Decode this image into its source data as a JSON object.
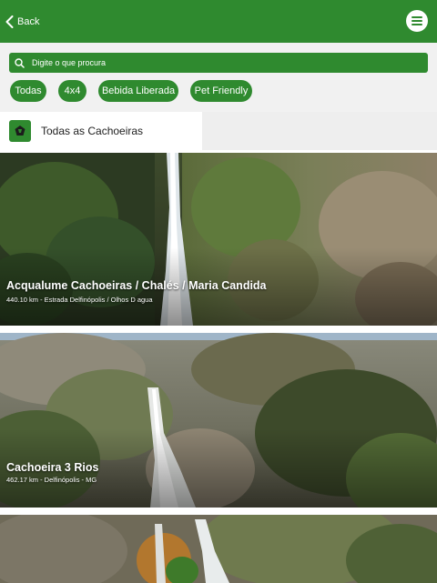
{
  "header": {
    "back_label": "Back",
    "back_icon": "chevron-left-icon",
    "menu_icon": "hamburger-menu-icon",
    "accent_color": "#2f8a2f"
  },
  "search": {
    "placeholder": "Digite o que procura",
    "icon": "search-icon"
  },
  "chips": [
    {
      "label": "Todas"
    },
    {
      "label": "4x4"
    },
    {
      "label": "Bebida Liberada"
    },
    {
      "label": "Pet Friendly"
    }
  ],
  "category": {
    "label": "Todas as Cachoeiras",
    "icon": "waterfall-badge-icon"
  },
  "cards": [
    {
      "title": "Acqualume Cachoeiras / Chalés / Maria Candida",
      "subtitle": "440.10 km - Estrada Delfinópolis / Olhos D agua"
    },
    {
      "title": "Cachoeira 3 Rios",
      "subtitle": "462.17 km - Delfinópolis - MG"
    },
    {
      "title": "",
      "subtitle": ""
    }
  ]
}
